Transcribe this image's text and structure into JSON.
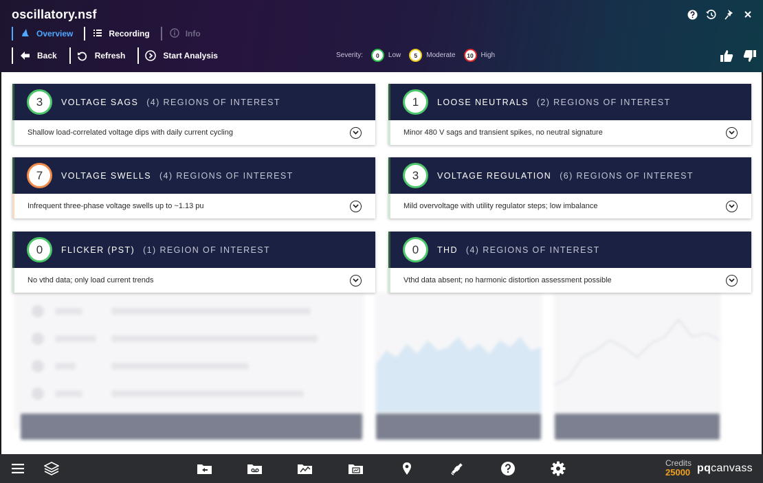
{
  "app": {
    "title": "oscillatory.nsf"
  },
  "tabs": [
    {
      "label": "Overview",
      "icon": "wizard-hat-icon"
    },
    {
      "label": "Recording",
      "icon": "list-icon"
    },
    {
      "label": "Info",
      "icon": "info-icon"
    }
  ],
  "toolbar": {
    "back": "Back",
    "refresh": "Refresh",
    "start_analysis": "Start Analysis"
  },
  "severity": {
    "label": "Severity:",
    "low_value": "0",
    "low_label": "Low",
    "moderate_value": "5",
    "moderate_label": "Moderate",
    "high_value": "10",
    "high_label": "High",
    "colors": {
      "low": "#2ec04a",
      "moderate": "#f1cf1f",
      "high": "#e02c2c"
    }
  },
  "cards": [
    {
      "score": "3",
      "title": "VOLTAGE SAGS",
      "subtitle": "(4) REGIONS OF INTEREST",
      "description": "Shallow load-correlated voltage dips with daily current cycling"
    },
    {
      "score": "1",
      "title": "LOOSE NEUTRALS",
      "subtitle": "(2) REGIONS OF INTEREST",
      "description": "Minor 480 V sags and transient spikes, no neutral signature"
    },
    {
      "score": "7",
      "title": "VOLTAGE SWELLS",
      "subtitle": "(4) REGIONS OF INTEREST",
      "description": "Infrequent three-phase voltage swells up to ~1.13 pu"
    },
    {
      "score": "3",
      "title": "VOLTAGE REGULATION",
      "subtitle": "(6) REGIONS OF INTEREST",
      "description": "Mild overvoltage with utility regulator steps; low imbalance"
    },
    {
      "score": "0",
      "title": "FLICKER (PST)",
      "subtitle": "(1) REGION OF INTEREST",
      "description": "No vthd data; only load current trends"
    },
    {
      "score": "0",
      "title": "THD",
      "subtitle": "(4) REGIONS OF INTEREST",
      "description": "Vthd data absent; no harmonic distortion assessment possible"
    }
  ],
  "footer": {
    "credits_label": "Credits",
    "credits_value": "25000",
    "brand_bold": "pq",
    "brand_rest": "canvass"
  },
  "theme": {
    "header_dark": "#1d1530",
    "card_header": "#1b2142",
    "accent_blue": "#4fa8ff",
    "credits_orange": "#f0a020"
  }
}
